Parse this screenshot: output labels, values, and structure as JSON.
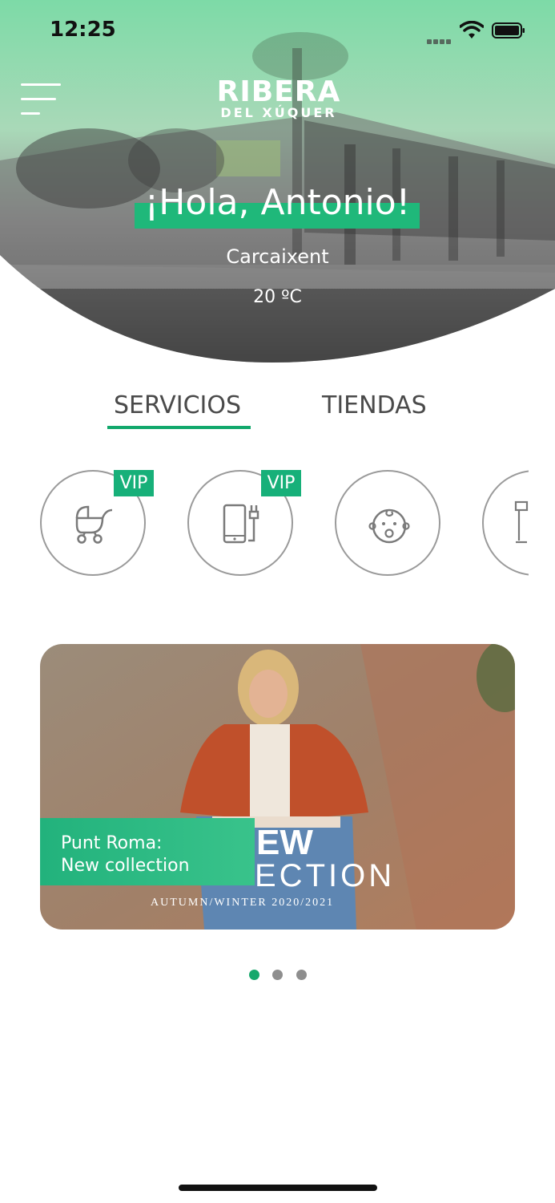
{
  "status_bar": {
    "time": "12:25"
  },
  "header": {
    "logo_main": "RIBERA",
    "logo_sub": "DEL XÚQUER",
    "greeting": "¡Hola, Antonio!",
    "city": "Carcaixent",
    "temperature": "20 ºC"
  },
  "tabs": [
    {
      "label": "SERVICIOS",
      "active": true
    },
    {
      "label": "TIENDAS",
      "active": false
    }
  ],
  "services": [
    {
      "icon": "stroller-icon",
      "badge": "VIP"
    },
    {
      "icon": "phone-charger-icon",
      "badge": "VIP"
    },
    {
      "icon": "baby-face-icon",
      "badge": ""
    },
    {
      "icon": "partial-service-icon",
      "badge": ""
    }
  ],
  "banner": {
    "caption_line1": "Punt Roma:",
    "caption_line2": "New collection",
    "image_text_1": "EW",
    "image_text_2": "ECTION",
    "image_text_3": "AUTUMN/WINTER 2020/2021"
  },
  "carousel": {
    "pages": 3,
    "active_index": 0
  },
  "colors": {
    "accent": "#12a86c",
    "hero_tint": "#7ddaa7"
  }
}
